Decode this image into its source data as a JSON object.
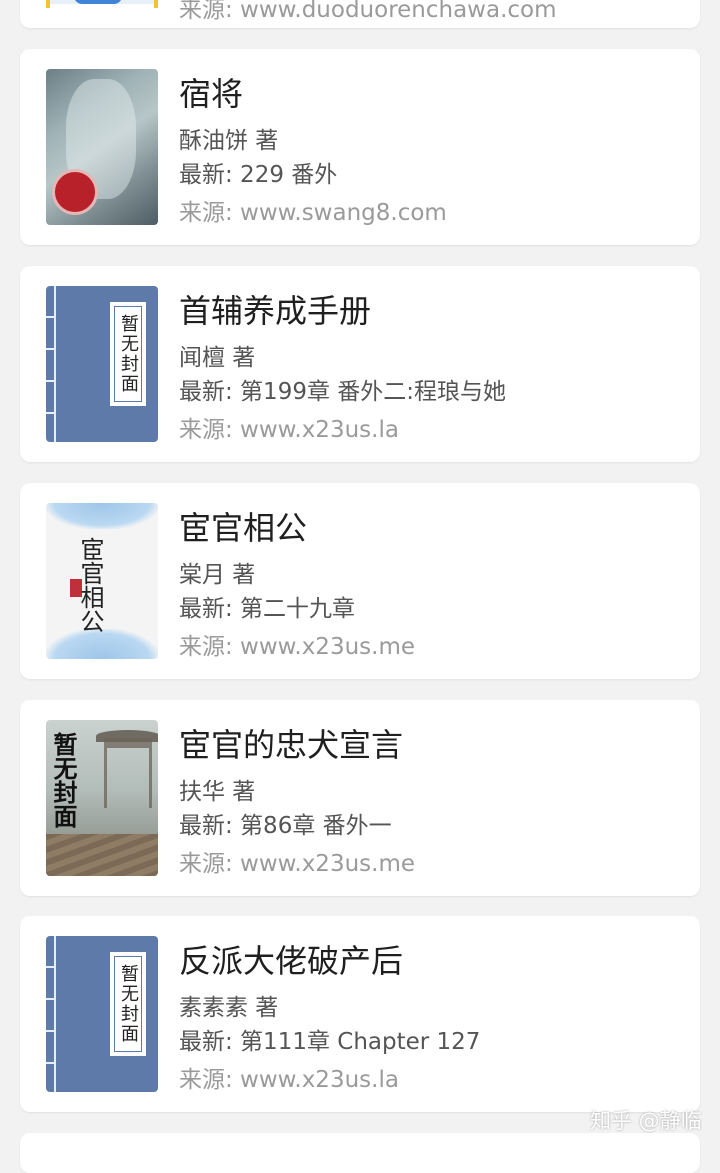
{
  "books": [
    {
      "title": "宿将",
      "author": "酥油饼 著",
      "latest": "最新: 229 番外",
      "source": "来源: www.swang8.com",
      "cover": "illustrated-warrior"
    },
    {
      "title": "首辅养成手册",
      "author": "闻檀 著",
      "latest": "最新: 第199章 番外二:程琅与她",
      "source": "来源: www.x23us.la",
      "cover": "placeholder",
      "cover_text": "暂无封面"
    },
    {
      "title": "宦官相公",
      "author": "棠月 著",
      "latest": "最新: 第二十九章",
      "source": "来源: www.x23us.me",
      "cover": "illustrated-calligraphy",
      "cover_text": "宦官相公"
    },
    {
      "title": "宦官的忠犬宣言",
      "author": "扶华 著",
      "latest": "最新: 第86章 番外一",
      "source": "来源: www.x23us.me",
      "cover": "illustrated-pavilion",
      "cover_text": "暂无封面"
    },
    {
      "title": "反派大佬破产后",
      "author": "素素素 著",
      "latest": "最新: 第111章 Chapter 127",
      "source": "来源: www.x23us.la",
      "cover": "placeholder",
      "cover_text": "暂无封面"
    }
  ],
  "top_partial": {
    "source": "来源: www.duoduorenchawa.com"
  },
  "watermark": "知乎 @静临",
  "colors": {
    "background": "#f2f2f2",
    "card": "#ffffff",
    "placeholder_cover": "#5d7aa8",
    "title": "#1f1f1f",
    "meta": "#555555",
    "source": "#9a9a9a"
  }
}
